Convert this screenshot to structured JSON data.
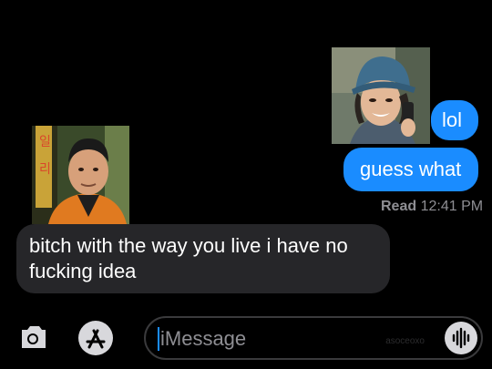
{
  "messages": [
    {
      "side": "right",
      "text": "lol"
    },
    {
      "side": "right",
      "text": "guess what"
    },
    {
      "side": "left",
      "text": "bitch with the way you live i have no fucking idea"
    }
  ],
  "receipt": {
    "status": "Read",
    "time": "12:41 PM"
  },
  "input": {
    "placeholder": "iMessage",
    "watermark": "asoceoxo"
  },
  "photos": {
    "right_subject": "woman-in-blue-cap-on-phone",
    "left_subject": "man-in-orange-jacket-city-night"
  },
  "colors": {
    "background": "#000000",
    "sent_bubble": "#1a8cff",
    "received_bubble": "#262629",
    "meta_text": "#8e8e93"
  },
  "icons": [
    "camera-icon",
    "app-store-icon",
    "voice-waveform-icon"
  ]
}
